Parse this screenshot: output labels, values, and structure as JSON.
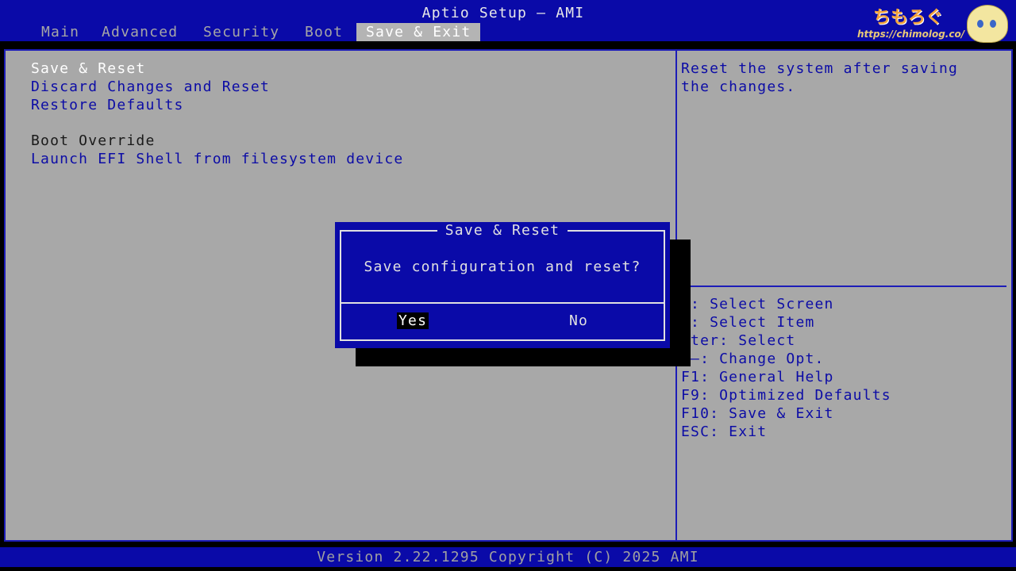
{
  "header": {
    "title": "Aptio Setup – AMI",
    "tabs": [
      {
        "label": "Main"
      },
      {
        "label": "Advanced"
      },
      {
        "label": "Security"
      },
      {
        "label": "Boot"
      },
      {
        "label": "Save & Exit",
        "active": true
      }
    ],
    "watermark": {
      "text": "ちもろぐ",
      "url": "https://chimolog.co/"
    }
  },
  "menu": {
    "items": [
      {
        "label": "Save & Reset",
        "selected": true
      },
      {
        "label": "Discard Changes and Reset"
      },
      {
        "label": "Restore Defaults"
      },
      {
        "label": "Boot Override"
      },
      {
        "label": "Launch EFI Shell from filesystem device"
      }
    ]
  },
  "help": {
    "description_line1": "Reset the system after saving",
    "description_line2": "the changes.",
    "keys": [
      "←: Select Screen",
      "↓: Select Item",
      "nter: Select",
      "/–: Change Opt.",
      "F1: General Help",
      "F9: Optimized Defaults",
      "F10: Save & Exit",
      "ESC: Exit"
    ]
  },
  "dialog": {
    "title": "Save & Reset",
    "message": "Save configuration and reset?",
    "yes_label": "Yes",
    "no_label": "No"
  },
  "footer": {
    "version": "Version 2.22.1295 Copyright (C) 2025 AMI"
  },
  "colors": {
    "bar_blue": "#0a0aa8",
    "panel_gray": "#a8a8a8",
    "link_blue": "#0c0ca6",
    "selected_text": "#ffffff"
  }
}
